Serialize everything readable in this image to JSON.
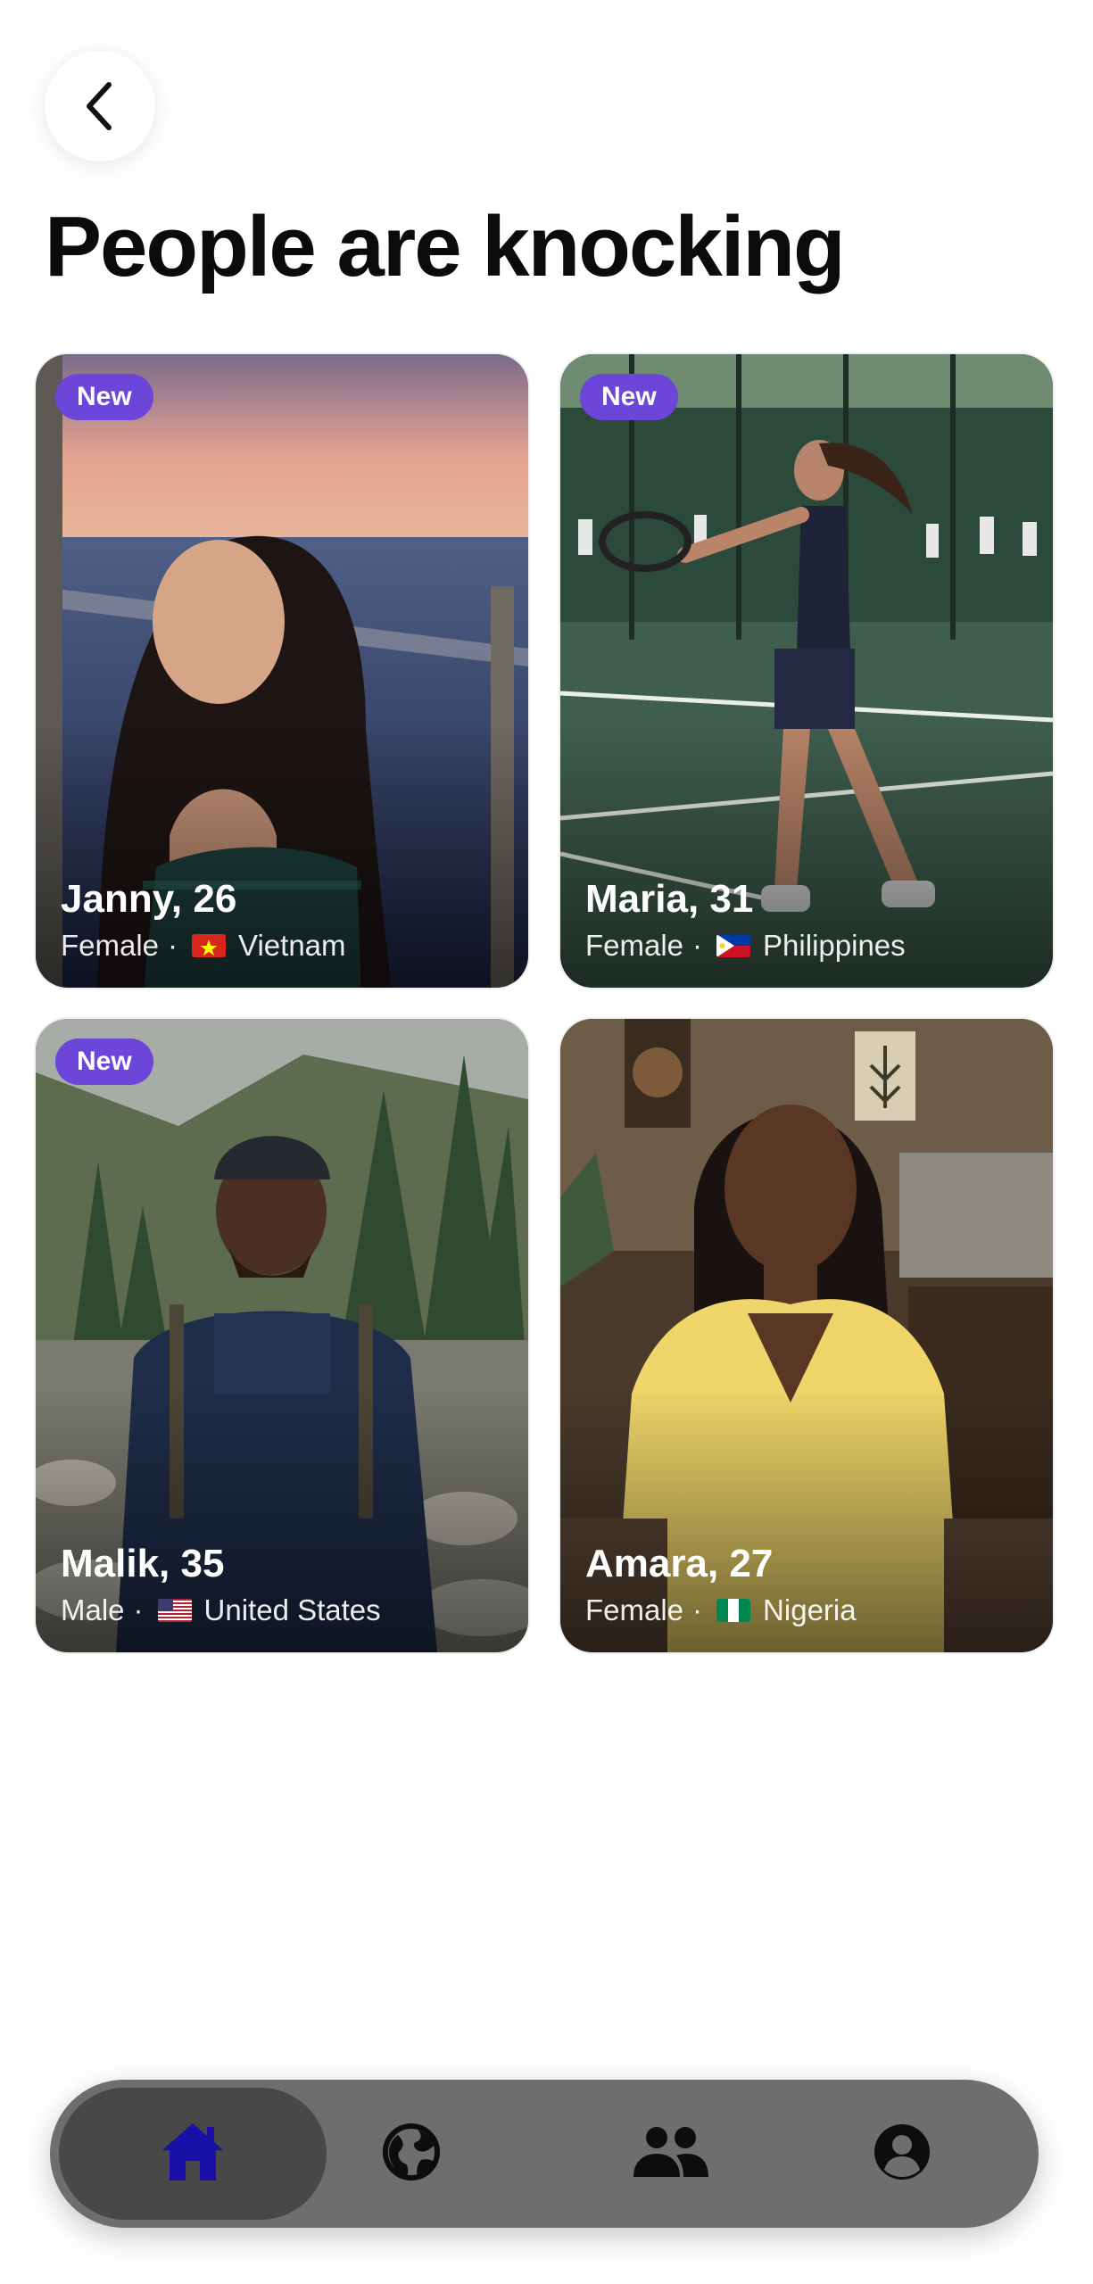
{
  "header": {
    "title": "People are knocking",
    "back_icon": "chevron-left-icon"
  },
  "badge_label": "New",
  "profiles": [
    {
      "name_age": "Janny, 26",
      "gender": "Female",
      "separator": "·",
      "country": "Vietnam",
      "flag": "vietnam-flag-icon",
      "is_new": true
    },
    {
      "name_age": "Maria, 31",
      "gender": "Female",
      "separator": "·",
      "country": "Philippines",
      "flag": "philippines-flag-icon",
      "is_new": true
    },
    {
      "name_age": "Malik, 35",
      "gender": "Male",
      "separator": "·",
      "country": "United States",
      "flag": "united-states-flag-icon",
      "is_new": true
    },
    {
      "name_age": "Amara, 27",
      "gender": "Female",
      "separator": "·",
      "country": "Nigeria",
      "flag": "nigeria-flag-icon",
      "is_new": false
    }
  ],
  "tabbar": {
    "items": [
      {
        "icon": "home-icon",
        "active": true
      },
      {
        "icon": "globe-icon",
        "active": false
      },
      {
        "icon": "people-icon",
        "active": false
      },
      {
        "icon": "profile-icon",
        "active": false
      }
    ]
  },
  "colors": {
    "badge": "#6b46d9",
    "tabbar": "#6e6e6e",
    "tab_active": "#484848",
    "home_icon_active": "#1a0fa6"
  }
}
